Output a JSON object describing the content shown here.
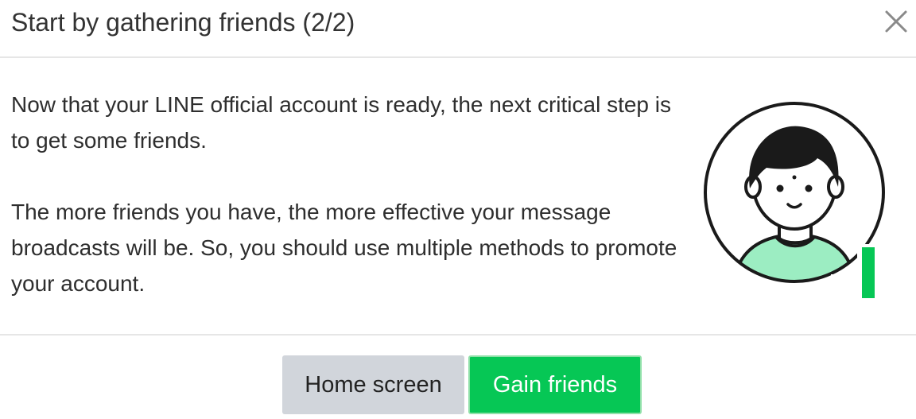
{
  "dialog": {
    "title": "Start by gathering friends (2/2)",
    "close_icon": "close-icon"
  },
  "body": {
    "paragraph_1": "Now that your LINE official account is ready, the next critical step is to get some friends.",
    "paragraph_2": "The more friends you have, the more effective your message broadcasts will be. So, you should use multiple methods to pro­mote your account.",
    "illustration_icon": "add-friend-avatar-icon"
  },
  "footer": {
    "home_button_label": "Home screen",
    "gain_button_label": "Gain friends"
  },
  "colors": {
    "accent_green": "#06c755",
    "shirt_green": "#9cedc2",
    "secondary_button": "#d1d5db",
    "divider": "#e6e6e6",
    "text": "#2e2e2e"
  }
}
